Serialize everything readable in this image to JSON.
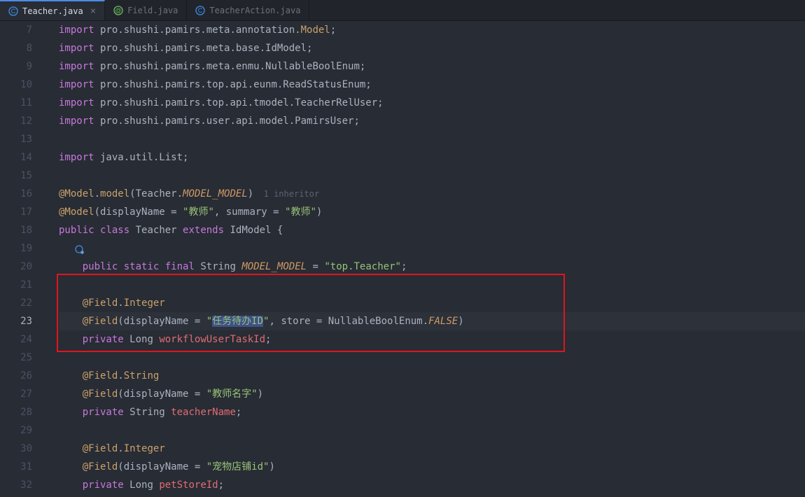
{
  "tabs": [
    {
      "label": "Teacher.java",
      "active": true,
      "closeable": true
    },
    {
      "label": "Field.java",
      "active": false,
      "closeable": false
    },
    {
      "label": "TeacherAction.java",
      "active": false,
      "closeable": false
    }
  ],
  "lines": {
    "start": 7,
    "l7": {
      "kw": "import",
      "rest": " pro.shushi.pamirs.meta.annotation.",
      "type": "Model",
      "end": ";"
    },
    "l8": {
      "kw": "import",
      "rest": " pro.shushi.pamirs.meta.base.IdModel;"
    },
    "l9": {
      "kw": "import",
      "rest": " pro.shushi.pamirs.meta.enmu.NullableBoolEnum;"
    },
    "l10": {
      "kw": "import",
      "rest": " pro.shushi.pamirs.top.api.eunm.ReadStatusEnum;"
    },
    "l11": {
      "kw": "import",
      "rest": " pro.shushi.pamirs.top.api.tmodel.TeacherRelUser;"
    },
    "l12": {
      "kw": "import",
      "rest": " pro.shushi.pamirs.user.api.model.PamirsUser;"
    },
    "l14": {
      "kw": "import",
      "rest": " java.util.List;"
    },
    "l16": {
      "ann1": "@Model",
      "dot": ".",
      "fn": "model",
      "open": "(Teacher.",
      "constant": "MODEL_MODEL",
      "close": ")",
      "hint": "  1 inheritor"
    },
    "l17": {
      "ann": "@Model",
      "open": "(displayName = ",
      "s1": "\"教师\"",
      "mid": ", summary = ",
      "s2": "\"教师\"",
      "close": ")"
    },
    "l18": {
      "kw1": "public",
      "kw2": "class",
      "name": " Teacher ",
      "kw3": "extends",
      "base": " IdModel {"
    },
    "l20": {
      "kw1": "public",
      "kw2": "static",
      "kw3": "final",
      "t": " String ",
      "constant": "MODEL_MODEL",
      "eq": " = ",
      "s": "\"top.Teacher\"",
      "end": ";"
    },
    "l22": {
      "ann": "@Field",
      "dot": ".",
      "sub": "Integer"
    },
    "l23": {
      "ann": "@Field",
      "open": "(displayName = ",
      "q1": "\"",
      "sel": "任务待办ID",
      "q2": "\"",
      "mid": ", store = NullableBoolEnum.",
      "constant": "FALSE",
      "close": ")"
    },
    "l24": {
      "kw": "private",
      "t": " Long ",
      "m": "workflowUserTaskId",
      "end": ";"
    },
    "l26": {
      "ann": "@Field",
      "dot": ".",
      "sub": "String"
    },
    "l27": {
      "ann": "@Field",
      "open": "(displayName = ",
      "s": "\"教师名字\"",
      "close": ")"
    },
    "l28": {
      "kw": "private",
      "t": " String ",
      "m": "teacherName",
      "end": ";"
    },
    "l30": {
      "ann": "@Field",
      "dot": ".",
      "sub": "Integer"
    },
    "l31": {
      "ann": "@Field",
      "open": "(displayName = ",
      "s": "\"宠物店铺id\"",
      "close": ")"
    },
    "l32": {
      "kw": "private",
      "t": " Long ",
      "m": "petStoreId",
      "end": ";"
    }
  },
  "gutter": {
    "n7": "7",
    "n8": "8",
    "n9": "9",
    "n10": "10",
    "n11": "11",
    "n12": "12",
    "n13": "13",
    "n14": "14",
    "n15": "15",
    "n16": "16",
    "n17": "17",
    "n18": "18",
    "n19": "19",
    "n20": "20",
    "n21": "21",
    "n22": "22",
    "n23": "23",
    "n24": "24",
    "n25": "25",
    "n26": "26",
    "n27": "27",
    "n28": "28",
    "n29": "29",
    "n30": "30",
    "n31": "31",
    "n32": "32"
  }
}
